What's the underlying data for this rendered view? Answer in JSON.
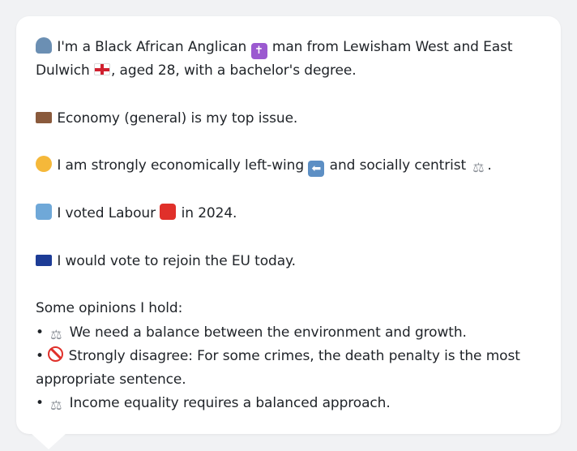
{
  "persona": {
    "intro_a": "I'm a Black African Anglican",
    "intro_b": "man from Lewisham West and East Dulwich",
    "intro_c": ", aged 28, with a bachelor's degree.",
    "top_issue": "Economy (general) is my top issue.",
    "ideology_a": "I am strongly economically left-wing",
    "ideology_b": "and socially centrist",
    "ideology_end": ".",
    "vote_a": "I voted Labour",
    "vote_b": "in 2024.",
    "eu": "I would vote to rejoin the EU today.",
    "opinions_header": "Some opinions I hold:",
    "opinions": [
      "We need a balance between the environment and growth.",
      "Strongly disagree: For some crimes, the death penalty is the most appropriate sentence.",
      "Income equality requires a balanced approach."
    ],
    "bullet": "•"
  },
  "icons": {
    "person": "bust-in-silhouette-icon",
    "religion": "latin-cross-icon",
    "flag": "england-flag-icon",
    "issue": "money-icon",
    "ideology": "thinking-face-icon",
    "left": "left-arrow-icon",
    "centrist": "balance-scale-icon",
    "vote": "ballot-box-icon",
    "party": "red-square-icon",
    "eu": "eu-flag-icon",
    "disagree": "prohibited-icon"
  }
}
